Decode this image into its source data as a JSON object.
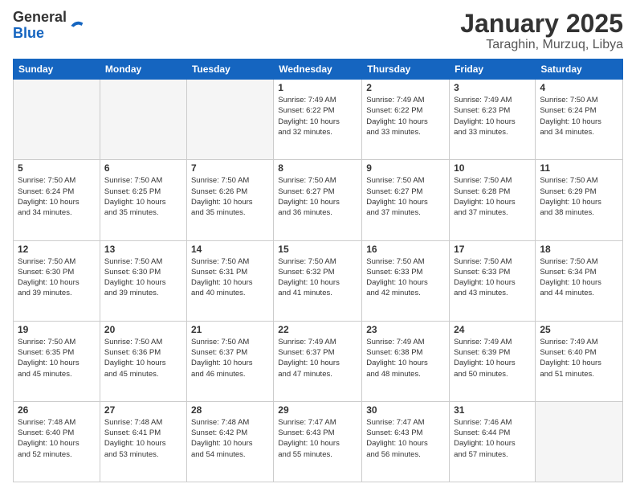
{
  "header": {
    "logo_general": "General",
    "logo_blue": "Blue",
    "title": "January 2025",
    "subtitle": "Taraghin, Murzuq, Libya"
  },
  "days_of_week": [
    "Sunday",
    "Monday",
    "Tuesday",
    "Wednesday",
    "Thursday",
    "Friday",
    "Saturday"
  ],
  "weeks": [
    [
      {
        "num": "",
        "info": ""
      },
      {
        "num": "",
        "info": ""
      },
      {
        "num": "",
        "info": ""
      },
      {
        "num": "1",
        "info": "Sunrise: 7:49 AM\nSunset: 6:22 PM\nDaylight: 10 hours\nand 32 minutes."
      },
      {
        "num": "2",
        "info": "Sunrise: 7:49 AM\nSunset: 6:22 PM\nDaylight: 10 hours\nand 33 minutes."
      },
      {
        "num": "3",
        "info": "Sunrise: 7:49 AM\nSunset: 6:23 PM\nDaylight: 10 hours\nand 33 minutes."
      },
      {
        "num": "4",
        "info": "Sunrise: 7:50 AM\nSunset: 6:24 PM\nDaylight: 10 hours\nand 34 minutes."
      }
    ],
    [
      {
        "num": "5",
        "info": "Sunrise: 7:50 AM\nSunset: 6:24 PM\nDaylight: 10 hours\nand 34 minutes."
      },
      {
        "num": "6",
        "info": "Sunrise: 7:50 AM\nSunset: 6:25 PM\nDaylight: 10 hours\nand 35 minutes."
      },
      {
        "num": "7",
        "info": "Sunrise: 7:50 AM\nSunset: 6:26 PM\nDaylight: 10 hours\nand 35 minutes."
      },
      {
        "num": "8",
        "info": "Sunrise: 7:50 AM\nSunset: 6:27 PM\nDaylight: 10 hours\nand 36 minutes."
      },
      {
        "num": "9",
        "info": "Sunrise: 7:50 AM\nSunset: 6:27 PM\nDaylight: 10 hours\nand 37 minutes."
      },
      {
        "num": "10",
        "info": "Sunrise: 7:50 AM\nSunset: 6:28 PM\nDaylight: 10 hours\nand 37 minutes."
      },
      {
        "num": "11",
        "info": "Sunrise: 7:50 AM\nSunset: 6:29 PM\nDaylight: 10 hours\nand 38 minutes."
      }
    ],
    [
      {
        "num": "12",
        "info": "Sunrise: 7:50 AM\nSunset: 6:30 PM\nDaylight: 10 hours\nand 39 minutes."
      },
      {
        "num": "13",
        "info": "Sunrise: 7:50 AM\nSunset: 6:30 PM\nDaylight: 10 hours\nand 39 minutes."
      },
      {
        "num": "14",
        "info": "Sunrise: 7:50 AM\nSunset: 6:31 PM\nDaylight: 10 hours\nand 40 minutes."
      },
      {
        "num": "15",
        "info": "Sunrise: 7:50 AM\nSunset: 6:32 PM\nDaylight: 10 hours\nand 41 minutes."
      },
      {
        "num": "16",
        "info": "Sunrise: 7:50 AM\nSunset: 6:33 PM\nDaylight: 10 hours\nand 42 minutes."
      },
      {
        "num": "17",
        "info": "Sunrise: 7:50 AM\nSunset: 6:33 PM\nDaylight: 10 hours\nand 43 minutes."
      },
      {
        "num": "18",
        "info": "Sunrise: 7:50 AM\nSunset: 6:34 PM\nDaylight: 10 hours\nand 44 minutes."
      }
    ],
    [
      {
        "num": "19",
        "info": "Sunrise: 7:50 AM\nSunset: 6:35 PM\nDaylight: 10 hours\nand 45 minutes."
      },
      {
        "num": "20",
        "info": "Sunrise: 7:50 AM\nSunset: 6:36 PM\nDaylight: 10 hours\nand 45 minutes."
      },
      {
        "num": "21",
        "info": "Sunrise: 7:50 AM\nSunset: 6:37 PM\nDaylight: 10 hours\nand 46 minutes."
      },
      {
        "num": "22",
        "info": "Sunrise: 7:49 AM\nSunset: 6:37 PM\nDaylight: 10 hours\nand 47 minutes."
      },
      {
        "num": "23",
        "info": "Sunrise: 7:49 AM\nSunset: 6:38 PM\nDaylight: 10 hours\nand 48 minutes."
      },
      {
        "num": "24",
        "info": "Sunrise: 7:49 AM\nSunset: 6:39 PM\nDaylight: 10 hours\nand 50 minutes."
      },
      {
        "num": "25",
        "info": "Sunrise: 7:49 AM\nSunset: 6:40 PM\nDaylight: 10 hours\nand 51 minutes."
      }
    ],
    [
      {
        "num": "26",
        "info": "Sunrise: 7:48 AM\nSunset: 6:40 PM\nDaylight: 10 hours\nand 52 minutes."
      },
      {
        "num": "27",
        "info": "Sunrise: 7:48 AM\nSunset: 6:41 PM\nDaylight: 10 hours\nand 53 minutes."
      },
      {
        "num": "28",
        "info": "Sunrise: 7:48 AM\nSunset: 6:42 PM\nDaylight: 10 hours\nand 54 minutes."
      },
      {
        "num": "29",
        "info": "Sunrise: 7:47 AM\nSunset: 6:43 PM\nDaylight: 10 hours\nand 55 minutes."
      },
      {
        "num": "30",
        "info": "Sunrise: 7:47 AM\nSunset: 6:43 PM\nDaylight: 10 hours\nand 56 minutes."
      },
      {
        "num": "31",
        "info": "Sunrise: 7:46 AM\nSunset: 6:44 PM\nDaylight: 10 hours\nand 57 minutes."
      },
      {
        "num": "",
        "info": ""
      }
    ]
  ]
}
